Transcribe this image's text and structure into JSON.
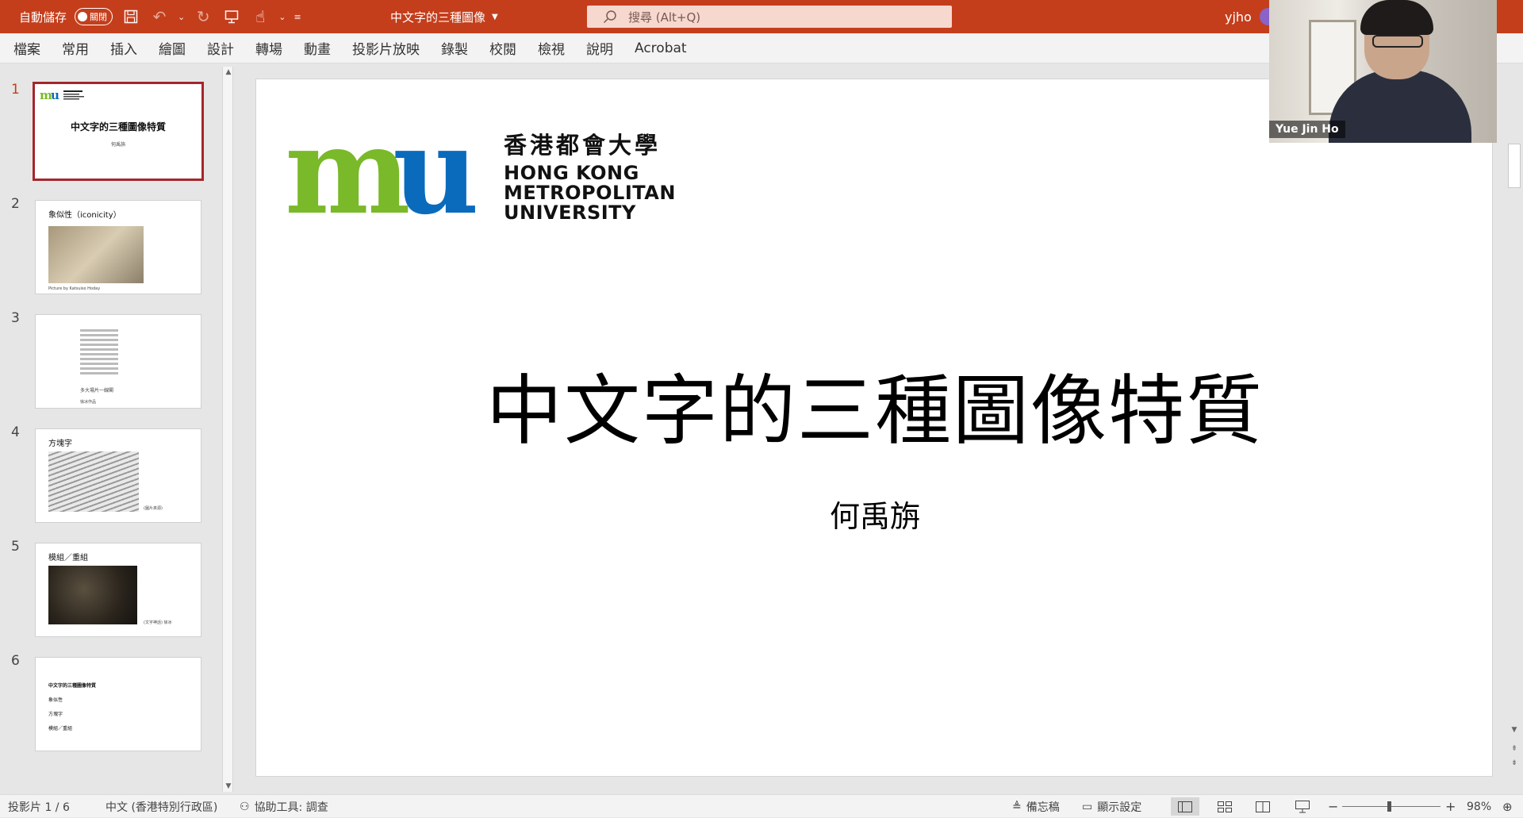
{
  "titlebar": {
    "autosave_label": "自動儲存",
    "autosave_state": "關閉",
    "doc_title": "中文字的三種圖像",
    "search_placeholder": "搜尋 (Alt+Q)",
    "user": "yjho",
    "bg_color": "#c43e1c"
  },
  "menu": [
    "檔案",
    "常用",
    "插入",
    "繪圖",
    "設計",
    "轉場",
    "動畫",
    "投影片放映",
    "錄製",
    "校閱",
    "檢視",
    "說明",
    "Acrobat"
  ],
  "thumbnails": [
    {
      "num": "1",
      "title": "中文字的三種圖像特質",
      "subtitle": "何禹旃"
    },
    {
      "num": "2",
      "title": "象似性（iconicity）",
      "caption": "Picture by Katsuiso Hoday"
    },
    {
      "num": "3",
      "caption_a": "多大場片一線閣",
      "caption_b": "徐冰作品"
    },
    {
      "num": "4",
      "title": "方塊字",
      "caption": "(圖片來源)"
    },
    {
      "num": "5",
      "title": "模組／重組",
      "caption": "(文字神話) 徐冰"
    },
    {
      "num": "6",
      "title": "中文字的三種圖像特質",
      "items": [
        "象似性",
        "方塊字",
        "模組／重組"
      ]
    }
  ],
  "slide": {
    "logo_zh": "香港都會大學",
    "logo_en": [
      "HONG KONG",
      "METROPOLITAN",
      "UNIVERSITY"
    ],
    "logo_green": "#7ab929",
    "logo_blue": "#0a6bbd",
    "title": "中文字的三種圖像特質",
    "subtitle": "何禹旃"
  },
  "video": {
    "participant": "Yue Jin Ho"
  },
  "status": {
    "slide_count": "投影片 1 / 6",
    "language": "中文 (香港特別行政區)",
    "accessibility": "協助工具: 調查",
    "notes": "備忘稿",
    "display_settings": "顯示設定",
    "zoom": "98%",
    "zoom_level": 0.48
  }
}
